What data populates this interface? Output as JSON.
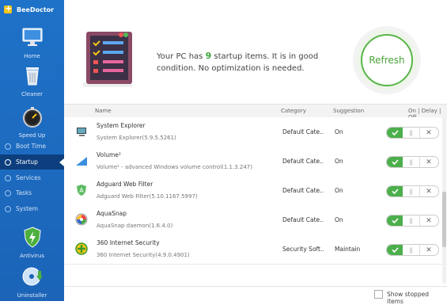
{
  "app": {
    "title": "BeeDoctor"
  },
  "nav": {
    "home": "Home",
    "cleaner": "Cleaner",
    "speedup": "Speed Up",
    "sub": [
      "Boot Time",
      "Startup",
      "Services",
      "Tasks",
      "System"
    ],
    "antivirus": "Antivirus",
    "uninstaller": "Uninstaller"
  },
  "summary": {
    "prefix": "Your PC has ",
    "count": "9",
    "suffix": " startup items. It is in good condition. No optimization is needed."
  },
  "refresh_label": "Refresh",
  "table": {
    "headers": {
      "name": "Name",
      "category": "Category",
      "suggestion": "Suggestion",
      "state": "On | Delay | Off"
    },
    "rows": [
      {
        "name": "System Explorer",
        "desc": "System Explorer(5.9.5.5261)",
        "category": "Default Cate…",
        "suggestion": "On",
        "icon": "system-explorer-icon"
      },
      {
        "name": "Volume²",
        "desc": "Volume² - advanced Windows volume control(1.1.3.247)",
        "category": "Default Cate…",
        "suggestion": "On",
        "icon": "volume-icon"
      },
      {
        "name": "Adguard Web Filter",
        "desc": "Adguard Web Filter(5.10.1167.5997)",
        "category": "Default Cate…",
        "suggestion": "On",
        "icon": "adguard-icon"
      },
      {
        "name": "AquaSnap",
        "desc": "AquaSnap daemon(1.6.4.0)",
        "category": "Default Cate…",
        "suggestion": "On",
        "icon": "aquasnap-icon"
      },
      {
        "name": "360 Internet Security",
        "desc": "360 Internet Security(4.9.0.4901)",
        "category": "Security Soft…",
        "suggestion": "Maintain",
        "icon": "360-security-icon"
      }
    ]
  },
  "footer": {
    "show_stopped": "Show stopped items"
  }
}
